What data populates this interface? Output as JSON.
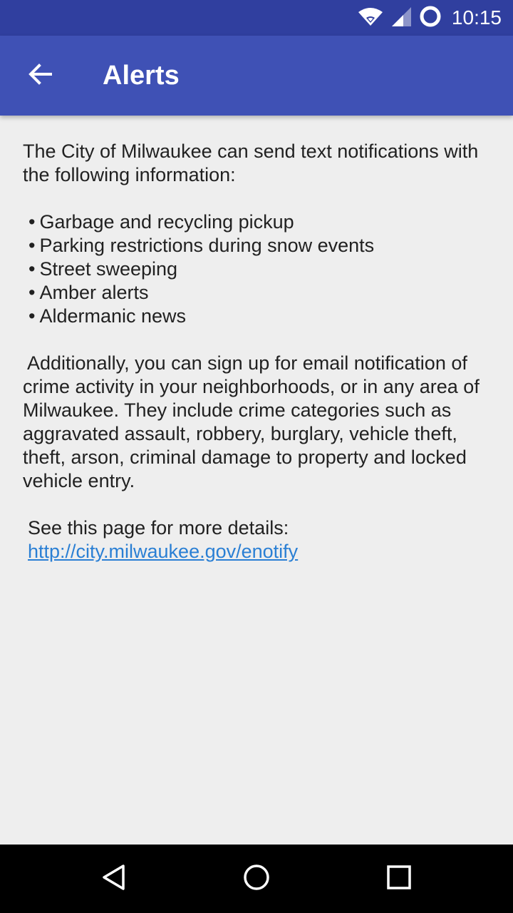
{
  "status_bar": {
    "time": "10:15",
    "icons": [
      "wifi-icon",
      "cell-signal-icon",
      "sync-icon"
    ]
  },
  "app_bar": {
    "title": "Alerts",
    "back_icon": "arrow-back-icon",
    "color": "#3f51b5"
  },
  "content": {
    "intro": "The City of Milwaukee can send text notifications with the following information:",
    "bullets": [
      "Garbage and recycling pickup",
      "Parking restrictions during snow events",
      "Street sweeping",
      "Amber alerts",
      "Aldermanic news"
    ],
    "para2": "Additionally, you can sign up for email notification of crime activity in your neighborhoods, or in any area of Milwaukee. They include crime categories such as aggravated assault, robbery, burglary, vehicle theft, theft, arson, criminal damage to property and locked vehicle entry.",
    "details_label": "See this page for more details:",
    "link": "http://city.milwaukee.gov/enotify",
    "link_color": "#2a7fd4"
  },
  "nav_bar": {
    "icons": [
      "back-triangle-icon",
      "home-circle-icon",
      "recents-square-icon"
    ]
  }
}
